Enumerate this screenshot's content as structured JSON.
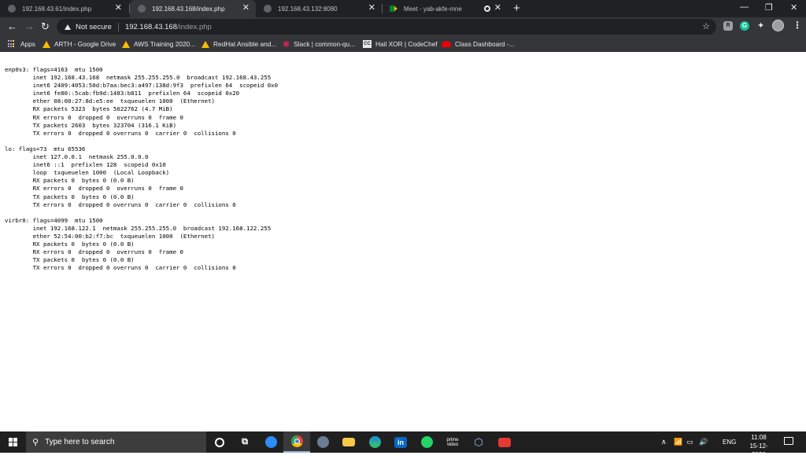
{
  "browser": {
    "tabs": [
      {
        "title": "192.168.43.61/index.php",
        "active": false
      },
      {
        "title": "192.168.43.168/index.php",
        "active": true
      },
      {
        "title": "192.168.43.132:8080",
        "active": false
      },
      {
        "title": "Meet - yab-akfe-mne",
        "active": false
      }
    ],
    "icons": {
      "new_tab": "+",
      "close": "✕",
      "minimize": "—",
      "maximize": "❐",
      "back": "←",
      "forward": "→",
      "reload": "↻",
      "star": "☆",
      "extensions": "✦",
      "menu": "⋮",
      "grammarly": "G",
      "extension_1": "R"
    },
    "address_bar": {
      "security_label": "Not secure",
      "host": "192.168.43.168",
      "path": "/index.php"
    },
    "bookmarks": [
      {
        "label": "Apps"
      },
      {
        "label": "ARTH - Google Drive"
      },
      {
        "label": "AWS Training 2020..."
      },
      {
        "label": "RedHat Ansible and..."
      },
      {
        "label": "Slack | common-qu..."
      },
      {
        "label": "Hail XOR | CodeChef"
      },
      {
        "label": "Class Dashboard -..."
      }
    ]
  },
  "page": {
    "output": "enp0s3: flags=4163  mtu 1500\n        inet 192.168.43.168  netmask 255.255.255.0  broadcast 192.168.43.255\n        inet6 2409:4053:50d:b7aa:bec3:a497:138d:9f3  prefixlen 64  scopeid 0x0\n        inet6 fe80::5cab:fb9d:1483:b811  prefixlen 64  scopeid 0x20\n        ether 08:00:27:8d:e5:ee  txqueuelen 1000  (Ethernet)\n        RX packets 5323  bytes 5022762 (4.7 MiB)\n        RX errors 0  dropped 0  overruns 0  frame 0\n        TX packets 2603  bytes 323704 (316.1 KiB)\n        TX errors 0  dropped 0 overruns 0  carrier 0  collisions 0\n\nlo: flags=73  mtu 65536\n        inet 127.0.0.1  netmask 255.0.0.0\n        inet6 ::1  prefixlen 128  scopeid 0x10\n        loop  txqueuelen 1000  (Local Loopback)\n        RX packets 0  bytes 0 (0.0 B)\n        RX errors 0  dropped 0  overruns 0  frame 0\n        TX packets 0  bytes 0 (0.0 B)\n        TX errors 0  dropped 0 overruns 0  carrier 0  collisions 0\n\nvirbr0: flags=4099  mtu 1500\n        inet 192.168.122.1  netmask 255.255.255.0  broadcast 192.168.122.255\n        ether 52:54:00:b2:f7:bc  txqueuelen 1000  (Ethernet)\n        RX packets 0  bytes 0 (0.0 B)\n        RX errors 0  dropped 0  overruns 0  frame 0\n        TX packets 0  bytes 0 (0.0 B)\n        TX errors 0  dropped 0 overruns 0  carrier 0  collisions 0"
  },
  "taskbar": {
    "search_placeholder": "Type here to search",
    "search_glyph": "⚲",
    "taskview_glyph": "⧉",
    "linkedin_label": "in",
    "prime_label_1": "prime",
    "prime_label_2": "video",
    "vbox_glyph": "⬡",
    "tray": {
      "chevron": "∧",
      "network": "📶",
      "battery": "▭",
      "volume": "🔊",
      "language": "ENG"
    },
    "time": "11:08",
    "date": "15-12-2020"
  },
  "colors": {
    "tab_strip": "#202124",
    "toolbar": "#35363a",
    "page_background": "#ffffff",
    "taskbar": "#1f1f1f"
  }
}
